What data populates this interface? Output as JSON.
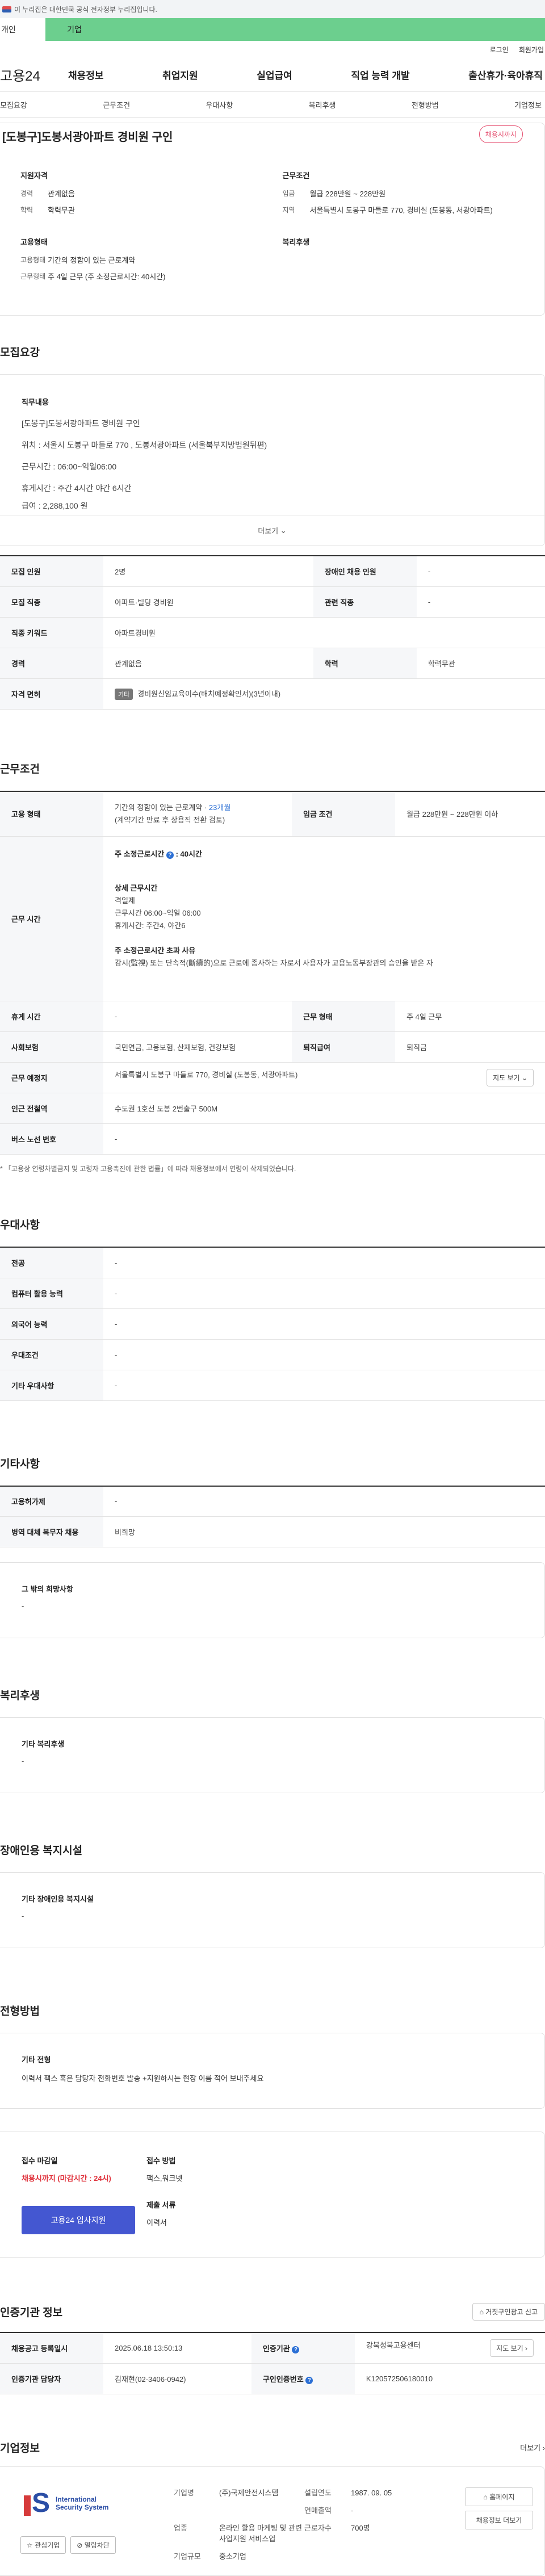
{
  "gov_bar": {
    "text": "이 누리집은 대한민국 공식 전자정부 누리집입니다."
  },
  "top_tabs": [
    "개인",
    "기업"
  ],
  "util": [
    "로그인",
    "회원가입"
  ],
  "logo": {
    "brand": "고용",
    "num": "24"
  },
  "gnb": [
    "채용정보",
    "취업지원",
    "실업급여",
    "직업 능력 개발",
    "출산휴가·육아휴직"
  ],
  "anchor": [
    "모집요강",
    "근무조건",
    "우대사항",
    "복리후생",
    "전형방법",
    "기업정보"
  ],
  "summary": {
    "title": "[도봉구]도봉서광아파트 경비원 구인",
    "badge": "채용시까지",
    "qual_title": "지원자격",
    "career_k": "경력",
    "career_v": "관계없음",
    "edu_k": "학력",
    "edu_v": "학력무관",
    "cond_title": "근무조건",
    "wage_k": "임금",
    "wage_v": "월급 228만원 ~ 228만원",
    "area_k": "지역",
    "area_v": "서울특별시 도봉구 마들로 770, 경비실 (도봉동, 서광아파트)",
    "emp_title": "고용형태",
    "type_k": "고용형태",
    "type_v": "기간의 정함이 있는 근로계약",
    "work_k": "근무형태",
    "work_v": "주 4일 근무 (주 소정근로시간: 40시간)",
    "welfare_title": "복리후생"
  },
  "recruit": {
    "title": "모집요강",
    "lab": "직무내용",
    "lines": [
      "[도봉구]도봉서광아파트 경비원 구인",
      "위치 : 서울시 도봉구 마들로 770 ,   도봉서광아파트 (서울북부지방법원뒤편)",
      "근무시간 : 06:00~익일06:00",
      "휴게시간 : 주간 4시간 야간 6시간",
      "급여 : 2,288,100 원"
    ],
    "more": "더보기"
  },
  "recruit_table": [
    [
      "모집 인원",
      "2명",
      "장애인 채용 인원",
      "-"
    ],
    [
      "모집 직종",
      "아파트·빌딩 경비원",
      "관련 직종",
      "-"
    ],
    [
      "직종 키워드",
      "아파트경비원",
      "",
      ""
    ],
    [
      "경력",
      "관계없음",
      "학력",
      "학력무관"
    ]
  ],
  "license": {
    "k": "자격 면허",
    "tag": "기타",
    "v": "경비원신임교육이수(배치예정확인서)(3년이내)"
  },
  "cond": {
    "title": "근무조건",
    "emp_k": "고용 형태",
    "emp_v1": "기간의 정함이 있는 근로계약 · ",
    "emp_period": "23개월",
    "emp_v2": "(계약기간 만료 후 상용직 전환 검토)",
    "wage_k": "임금 조건",
    "wage_v": "월급 228만원 ~ 228만원 이하",
    "time_k": "근무 시간",
    "t1": "주 소정근로시간",
    "t1b": "40시간",
    "t2": "상세 근무시간",
    "t3": "격일제",
    "t4": "근무시간 06:00~익일 06:00",
    "t5": "휴게시간: 주간4, 야간6",
    "t6": "주 소정근로시간 초과 사유",
    "t7": "감시(監視) 또는 단속적(斷續的)으로 근로에 종사하는 자로서 사용자가 고용노동부장관의 승인을 받은 자",
    "rest_k": "휴게 시간",
    "rest_v": "-",
    "form_k": "근무 형태",
    "form_v": "주 4일 근무",
    "ins_k": "사회보험",
    "ins_v": "국민연금, 고용보험, 산재보험, 건강보험",
    "ret_k": "퇴직급여",
    "ret_v": "퇴직금",
    "place_k": "근무 예정지",
    "place_v": "서울특별시 도봉구 마들로 770, 경비실 (도봉동, 서광아파트)",
    "map": "지도 보기",
    "sub_k": "인근 전철역",
    "sub_v": "수도권 1호선 도봉 2번출구 500M",
    "bus_k": "버스 노선 번호",
    "bus_v": "-",
    "note": "* 「고용상 연령차별금지 및 고령자 고용촉진에 관한 법률」에 따라 채용정보에서 연령이 삭제되었습니다."
  },
  "pref": {
    "title": "우대사항",
    "rows": [
      [
        "전공",
        "-"
      ],
      [
        "컴퓨터 활용 능력",
        "-"
      ],
      [
        "외국어 능력",
        "-"
      ],
      [
        "우대조건",
        "-"
      ],
      [
        "기타 우대사항",
        "-"
      ]
    ]
  },
  "etc": {
    "title": "기타사항",
    "rows": [
      [
        "고용허가제",
        "-"
      ],
      [
        "병역 대체 복무자 채용",
        "비희망"
      ]
    ],
    "wish_lab": "그 밖의 희망사항",
    "wish_v": "-"
  },
  "welfare": {
    "title": "복리후생",
    "lab": "기타 복리후생",
    "v": "-"
  },
  "disabled": {
    "title": "장애인용 복지시설",
    "lab": "기타 장애인용 복지시설",
    "v": "-"
  },
  "screen": {
    "title": "전형방법",
    "lab": "기타 전형",
    "v": "이력서 팩스 혹은 담당자 전화번호 발송 +지원하시는 현장 이름 적어 보내주세요",
    "dead_lab": "접수 마감일",
    "dead_v": "채용시까지 (마감시간 : 24시)",
    "way_lab": "접수 방법",
    "way_v": "팩스,워크넷",
    "doc_lab": "제출 서류",
    "doc_v": "이력서",
    "apply": "고용24 입사지원"
  },
  "authority": {
    "title": "인증기관 정보",
    "report": "거짓구인광고 신고",
    "reg_k": "채용공고 등록일시",
    "reg_v": "2025.06.18 13:50:13",
    "org_k": "인증기관",
    "org_v": "강북성북고용센터",
    "map": "지도 보기",
    "mgr_k": "인증기관 담당자",
    "mgr_v": "김재현(02-3406-0942)",
    "no_k": "구인인증번호",
    "no_v": "K120572506180010"
  },
  "company": {
    "title": "기업정보",
    "more": "더보기",
    "logo_text": [
      "International",
      "Security System"
    ],
    "fav": "관심기업",
    "block": "열람차단",
    "name_k": "기업명",
    "name_v": "(주)국제안전시스템",
    "year_k": "설립연도",
    "year_v": "1987. 09. 05",
    "sales_k": "연매출액",
    "sales_v": "-",
    "biz_k": "업종",
    "biz_v": "온라인 활용 마케팅 및 관련 사업지원 서비스업",
    "emp_k": "근로자수",
    "emp_v": "700명",
    "size_k": "기업규모",
    "size_v": "중소기업",
    "home": "홈페이지",
    "other": "채용정보 더보기"
  }
}
